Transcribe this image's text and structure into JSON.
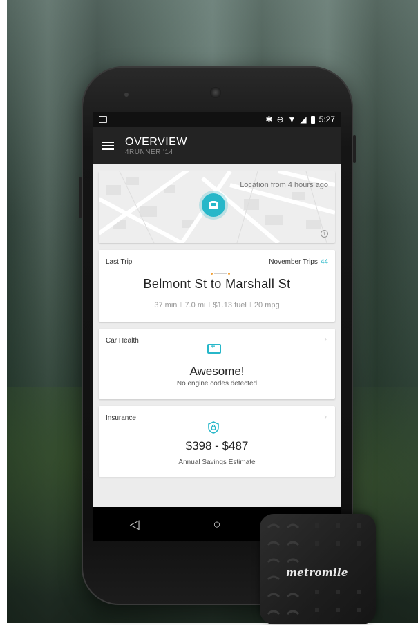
{
  "status_bar": {
    "time": "5:27"
  },
  "app_bar": {
    "title": "OVERVIEW",
    "subtitle": "4RUNNER '14"
  },
  "map": {
    "location_text": "Location from 4 hours ago"
  },
  "last_trip": {
    "label": "Last Trip",
    "monthly_label": "November Trips",
    "monthly_count": "44",
    "route": "Belmont St to Marshall St",
    "stats": [
      "37 min",
      "7.0 mi",
      "$1.13 fuel",
      "20 mpg"
    ]
  },
  "car_health": {
    "label": "Car Health",
    "status": "Awesome!",
    "description": "No engine codes detected"
  },
  "insurance": {
    "label": "Insurance",
    "value": "$398 - $487",
    "description": "Annual Savings Estimate"
  },
  "nav": {
    "back_icon": "◁",
    "home_icon": "○"
  },
  "device": {
    "brand": "metromile"
  },
  "colors": {
    "accent": "#27b7c9",
    "app_bar": "#232323",
    "status_bar": "#111111"
  }
}
